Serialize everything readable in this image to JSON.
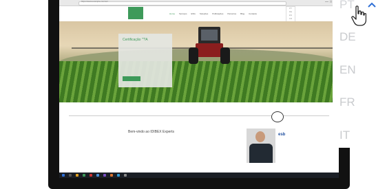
{
  "browser": {
    "url": "https://www.example.com/en/",
    "window_controls": [
      "—",
      "□",
      "×"
    ]
  },
  "site": {
    "logo_text": "",
    "nav": [
      "Home",
      "Serviços",
      "ESG",
      "Soluções",
      "Publicações",
      "Parceiros",
      "Blog",
      "Contacto"
    ],
    "active_nav_index": 0,
    "mini_dropdown": [
      "PT",
      "DE",
      "EN",
      "FR",
      "IT"
    ]
  },
  "hero": {
    "card_title": "Certificação '\"?A",
    "card_text": "",
    "card_button": ""
  },
  "content": {
    "kicker": "",
    "title": "Bem-vindo ao IDIBEX Experts",
    "body": "",
    "caption_left": "",
    "cert_badge_text": "",
    "partner_logo": "esb",
    "person_caption": ""
  },
  "taskbar": {
    "clock": ""
  },
  "language_selector": {
    "options": [
      "PT",
      "DE",
      "EN",
      "FR",
      "IT"
    ],
    "selected": "PT"
  },
  "colors": {
    "brand_green": "#3e9a5a",
    "lang_text": "#c9cbce",
    "chevron": "#2f6fd6"
  }
}
